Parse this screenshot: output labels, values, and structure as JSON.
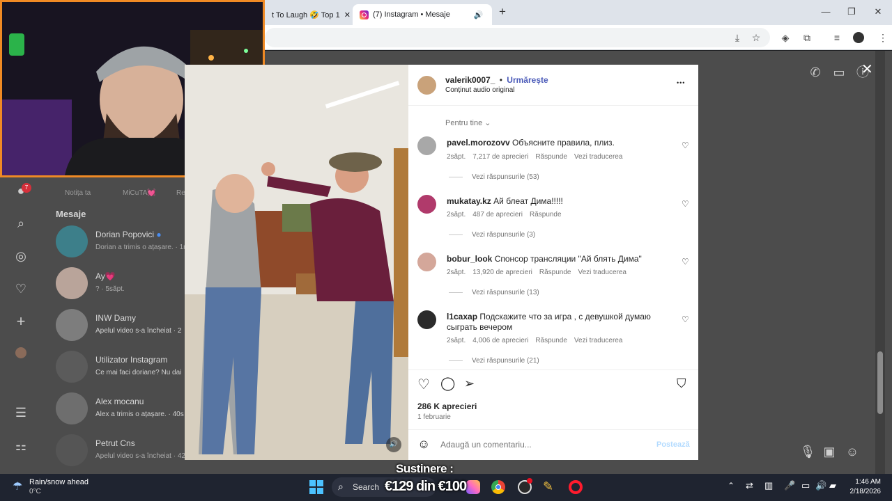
{
  "browser": {
    "tabs": [
      {
        "label": "t To Laugh 🤣 Top 1"
      },
      {
        "label": "(7) Instagram • Mesaje"
      }
    ],
    "new_tab": "+",
    "window_controls": {
      "minimize": "—",
      "maximize": "❐",
      "close": "✕"
    }
  },
  "sidebar": {
    "notification_badge": "7",
    "notes": [
      "Notița ta",
      "MiCuTA💓",
      "Re"
    ]
  },
  "messages": {
    "heading": "Mesaje",
    "conversations": [
      {
        "name": "Dorian Popovici",
        "preview": "Dorian a trimis o ațașare. · 1m"
      },
      {
        "name": "Ay💗",
        "preview": "? · 5săpt."
      },
      {
        "name": "INW Damy",
        "preview": "Apelul video s-a încheiat · 2"
      },
      {
        "name": "Utilizator Instagram",
        "preview": "Ce mai faci doriane? Nu dai"
      },
      {
        "name": "Alex mocanu",
        "preview": "Alex a trimis o ațașare. · 40s"
      },
      {
        "name": "Petrut Cns",
        "preview": "Apelul video s-a încheiat · 42s"
      }
    ]
  },
  "post": {
    "username": "valerik0007_",
    "separator": "•",
    "follow": "Urmărește",
    "audio": "Conținut audio original",
    "more": "•••",
    "sort": "Pentru tine",
    "comments": [
      {
        "user": "pavel.morozovv",
        "text": "Объясните правила, плиз.",
        "age": "2săpt.",
        "likes": "7,217 de aprecieri",
        "reply": "Răspunde",
        "translate": "Vezi traducerea",
        "replies": "Vezi răspunsurile (53)"
      },
      {
        "user": "mukatay.kz",
        "text": "Ай блеат Дима!!!!!",
        "age": "2săpt.",
        "likes": "487 de aprecieri",
        "reply": "Răspunde",
        "translate": "",
        "replies": "Vezi răspunsurile (3)"
      },
      {
        "user": "bobur_look",
        "text": "Спонсор трансляции \"Ай блять Дима\"",
        "age": "2săpt.",
        "likes": "13,920 de aprecieri",
        "reply": "Răspunde",
        "translate": "Vezi traducerea",
        "replies": "Vezi răspunsurile (13)"
      },
      {
        "user": "l1caxap",
        "text": "Подскажите что за игра , с девушкой думаю сыграть вечером",
        "age": "2săpt.",
        "likes": "4,006 de aprecieri",
        "reply": "Răspunde",
        "translate": "Vezi traducerea",
        "replies": "Vezi răspunsurile (21)"
      }
    ],
    "total_likes": "286 K aprecieri",
    "date": "1 februarie",
    "comment_placeholder": "Adaugă un comentariu...",
    "post_button": "Postează"
  },
  "overlay": {
    "support_label": "Sustinere :",
    "goal_text": "€129 din €100"
  },
  "taskbar": {
    "weather_title": "Rain/snow ahead",
    "weather_temp": "0°C",
    "search": "Search",
    "time": "1:46 AM",
    "date": "2/18/2026"
  },
  "colors": {
    "accent": "#4a5ab8",
    "webcam_border": "#f08a24",
    "instagram_blue": "#0095f6"
  }
}
